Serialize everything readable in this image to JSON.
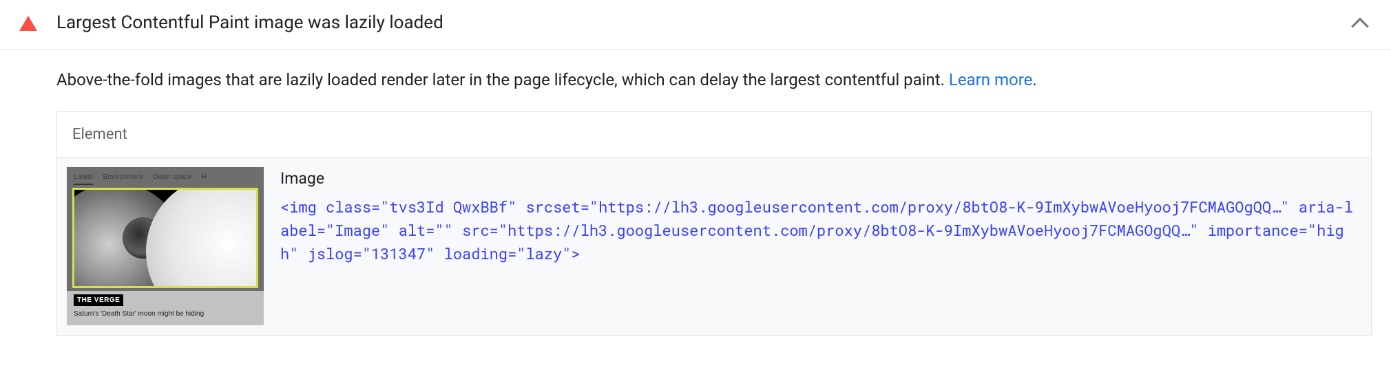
{
  "audit": {
    "status": "fail",
    "title": "Largest Contentful Paint image was lazily loaded",
    "description_text": "Above-the-fold images that are lazily loaded render later in the page lifecycle, which can delay the largest contentful paint. ",
    "learn_more_label": "Learn more",
    "table": {
      "header": "Element",
      "row": {
        "element_label": "Image",
        "thumbnail": {
          "tabs": [
            "Latest",
            "Environment",
            "Outer space",
            "H"
          ],
          "source_badge": "THE VERGE",
          "headline": "Saturn's 'Death Star' moon might be hiding"
        },
        "img_tag": {
          "open": "<img ",
          "attrs": [
            {
              "name": "class",
              "value": "tvs3Id QwxBBf"
            },
            {
              "name": "srcset",
              "value": "https://lh3.googleusercontent.com/proxy/8btO8-K-9ImXybwAVoeHyooj7FCMAGOgQQ…"
            },
            {
              "name": "aria-label",
              "value": "Image"
            },
            {
              "name": "alt",
              "value": ""
            },
            {
              "name": "src",
              "value": "https://lh3.googleusercontent.com/proxy/8btO8-K-9ImXybwAVoeHyooj7FCMAGOgQQ…"
            },
            {
              "name": "importance",
              "value": "high"
            },
            {
              "name": "jslog",
              "value": "131347"
            },
            {
              "name": "loading",
              "value": "lazy"
            }
          ],
          "close": ">"
        }
      }
    }
  }
}
